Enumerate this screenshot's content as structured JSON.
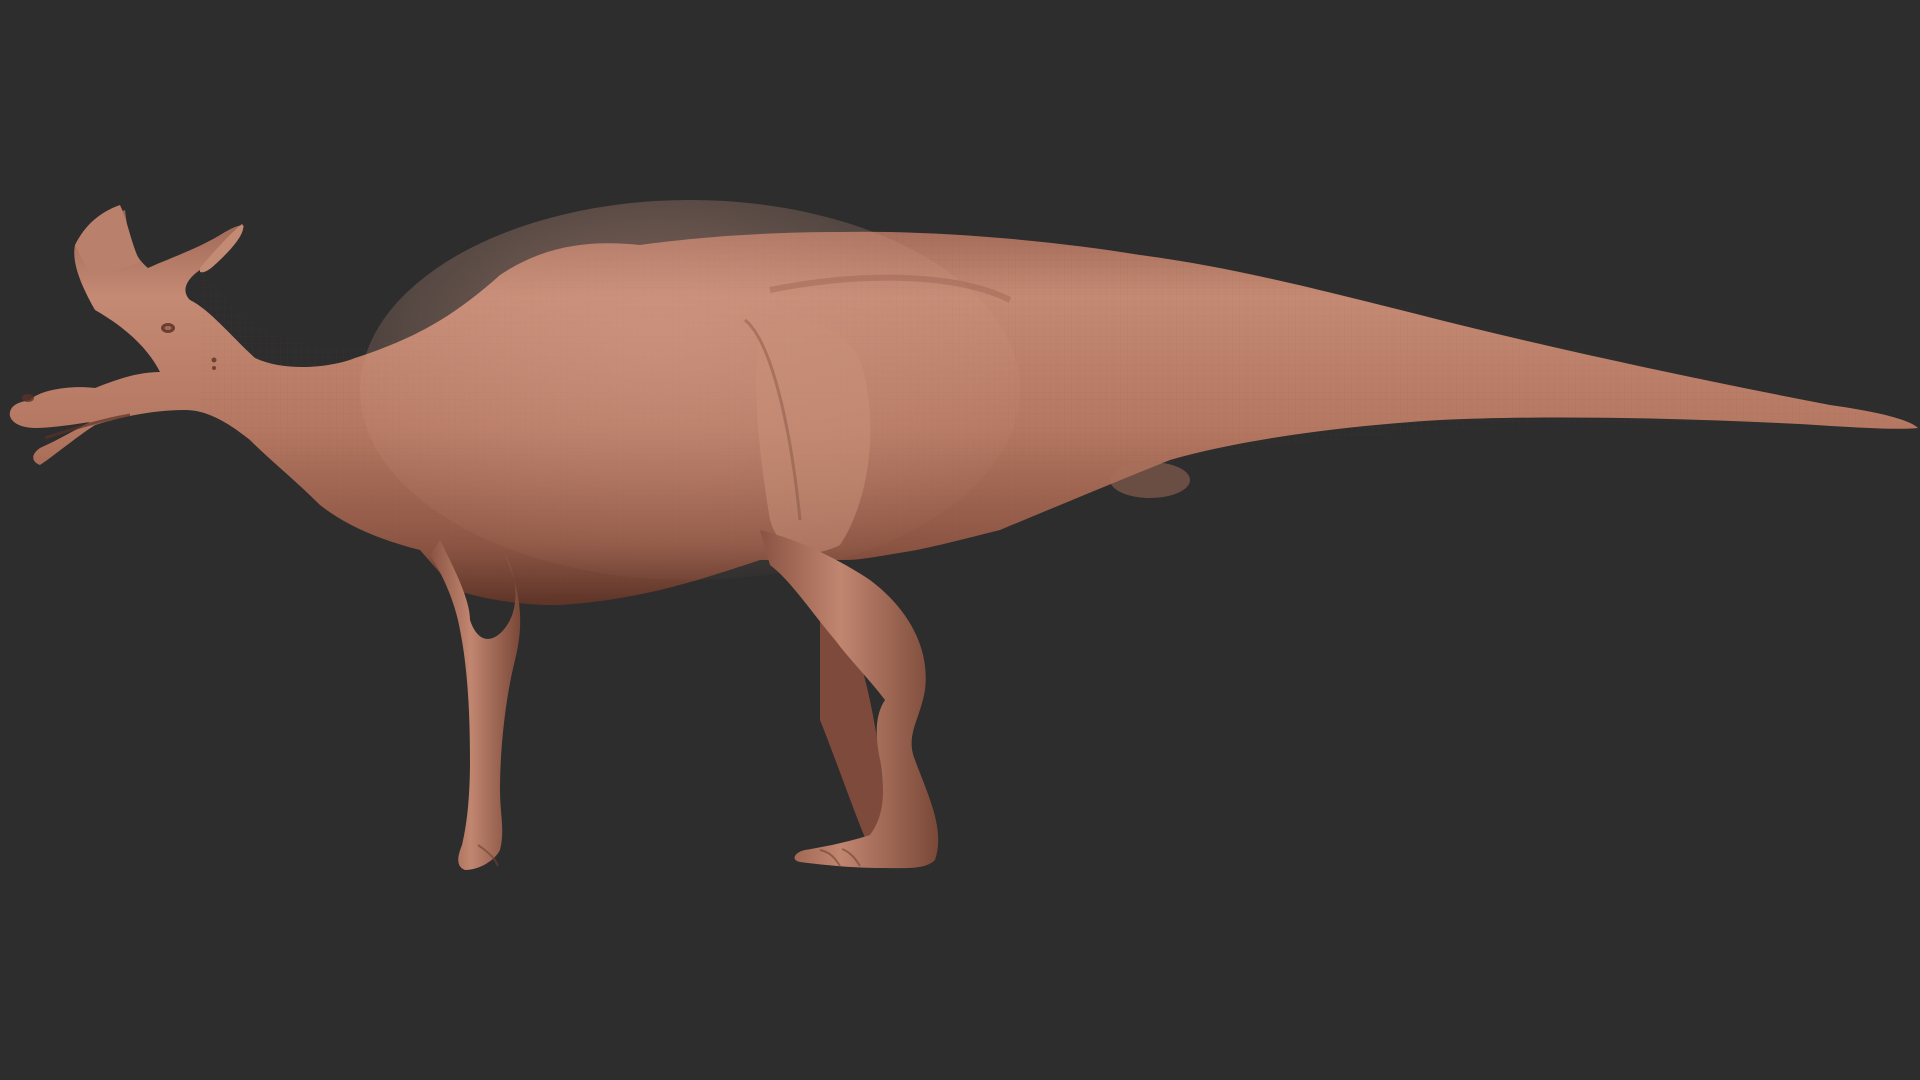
{
  "viewport": {
    "background_color": "#2d2d2d"
  },
  "model": {
    "subject": "lambeosaurus-sculpt",
    "material": "clay",
    "skin_color": "#b77a66",
    "skin_highlight": "#d09883",
    "skin_shadow": "#6f4234",
    "facing": "left",
    "view": "side"
  }
}
